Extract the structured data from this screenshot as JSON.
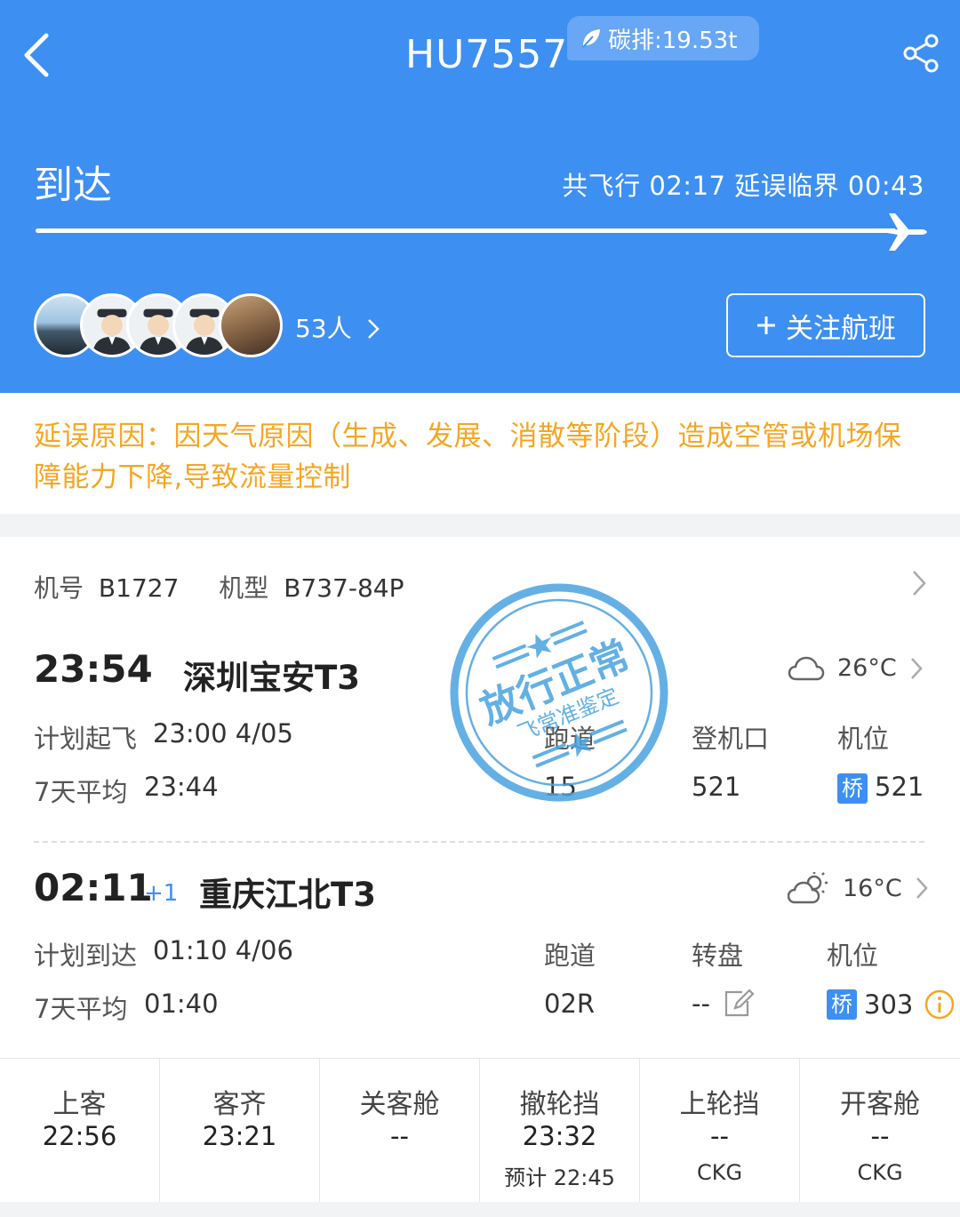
{
  "header": {
    "flight_number": "HU7557",
    "carbon_label": "碳排:19.53t",
    "status": "到达",
    "flight_info": "共飞行 02:17 延误临界 00:43",
    "followers": "53人",
    "follow_button": "关注航班",
    "progress": 1.0,
    "bg_color": "#3d8ff2"
  },
  "delay": {
    "text": "延误原因：因天气原因（生成、发展、消散等阶段）造成空管或机场保障能力下降,导致流量控制",
    "color": "#f5a623"
  },
  "aircraft": {
    "reg_label": "机号",
    "reg": "B1727",
    "type_label": "机型",
    "type": "B737-84P"
  },
  "departure": {
    "time": "23:54",
    "airport": "深圳宝安T3",
    "weather_icon": "cloud-icon",
    "temp": "26°C",
    "scheduled_label": "计划起飞",
    "scheduled": "23:00 4/05",
    "avg_label": "7天平均",
    "avg": "23:44",
    "runway_label": "跑道",
    "runway": "15",
    "gate_label": "登机口",
    "gate": "521",
    "stand_label": "机位",
    "stand_badge": "桥",
    "stand": "521"
  },
  "arrival": {
    "time": "02:11",
    "day_offset": "+1",
    "airport": "重庆江北T3",
    "weather_icon": "partly-cloudy-icon",
    "temp": "16°C",
    "scheduled_label": "计划到达",
    "scheduled": "01:10 4/06",
    "avg_label": "7天平均",
    "avg": "01:40",
    "runway_label": "跑道",
    "runway": "02R",
    "carousel_label": "转盘",
    "carousel": "--",
    "stand_label": "机位",
    "stand_badge": "桥",
    "stand": "303"
  },
  "stamp": {
    "main": "放行正常",
    "sub": "飞常准鉴定"
  },
  "timeline": [
    {
      "label": "上客",
      "value": "22:56",
      "sub": ""
    },
    {
      "label": "客齐",
      "value": "23:21",
      "sub": ""
    },
    {
      "label": "关客舱",
      "value": "--",
      "sub": ""
    },
    {
      "label": "撤轮挡",
      "value": "23:32",
      "sub": "预计 22:45"
    },
    {
      "label": "上轮挡",
      "value": "--",
      "sub": "CKG"
    },
    {
      "label": "开客舱",
      "value": "--",
      "sub": "CKG"
    }
  ]
}
